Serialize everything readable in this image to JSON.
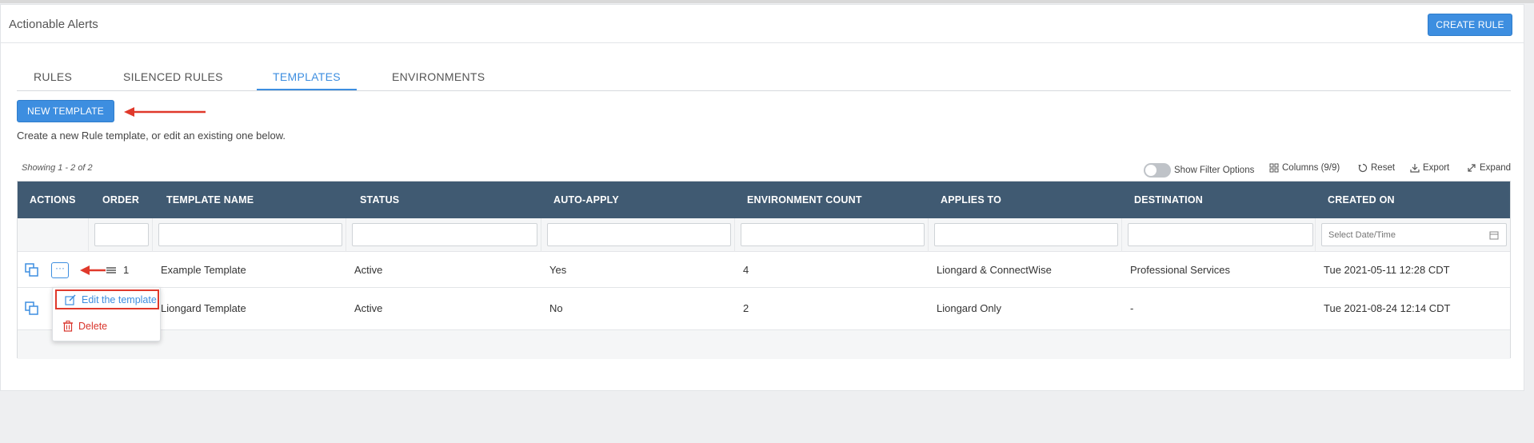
{
  "header": {
    "title": "Actionable Alerts",
    "create_rule_label": "CREATE RULE"
  },
  "tabs": [
    {
      "label": "RULES",
      "active": false
    },
    {
      "label": "SILENCED RULES",
      "active": false
    },
    {
      "label": "TEMPLATES",
      "active": true
    },
    {
      "label": "ENVIRONMENTS",
      "active": false
    }
  ],
  "templates": {
    "new_template_label": "NEW TEMPLATE",
    "helper_text": "Create a new Rule template, or edit an existing one below."
  },
  "table": {
    "showing": "Showing 1 - 2 of 2",
    "toolbar": {
      "filter_toggle_label": "Show Filter Options",
      "columns_label": "Columns (9/9)",
      "reset_label": "Reset",
      "export_label": "Export",
      "expand_label": "Expand"
    },
    "columns": [
      "ACTIONS",
      "ORDER",
      "TEMPLATE NAME",
      "STATUS",
      "AUTO-APPLY",
      "ENVIRONMENT COUNT",
      "APPLIES TO",
      "DESTINATION",
      "CREATED ON"
    ],
    "date_filter_placeholder": "Select Date/Time",
    "rows": [
      {
        "order": "1",
        "name": "Example Template",
        "status": "Active",
        "auto_apply": "Yes",
        "env_count": "4",
        "applies_to": "Liongard & ConnectWise",
        "destination": "Professional Services",
        "created_on": "Tue 2021-05-11 12:28 CDT"
      },
      {
        "order": "",
        "name": "Liongard Template",
        "status": "Active",
        "auto_apply": "No",
        "env_count": "2",
        "applies_to": "Liongard Only",
        "destination": "-",
        "created_on": "Tue 2021-08-24 12:14 CDT"
      }
    ]
  },
  "context_menu": {
    "edit_label": "Edit the template",
    "delete_label": "Delete"
  },
  "colors": {
    "accent": "#3d8ee0",
    "header_bg": "#405a72",
    "annotation_red": "#e0392b",
    "delete_red": "#d9342b"
  }
}
